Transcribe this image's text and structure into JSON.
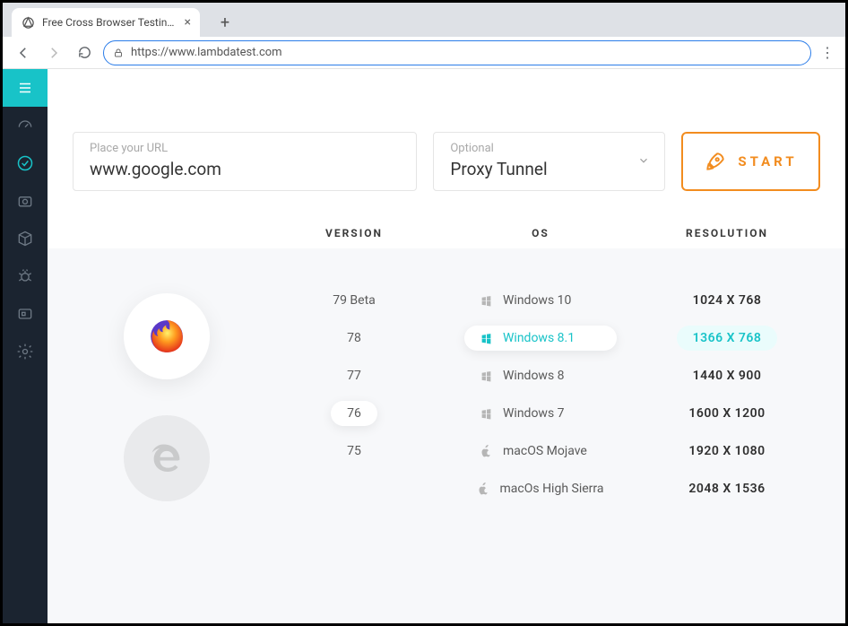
{
  "browser": {
    "tab_title": "Free Cross Browser Testing Clou",
    "url": "https://www.lambdatest.com"
  },
  "inputs": {
    "url_placeholder": "Place your URL",
    "url_value": "www.google.com",
    "proxy_placeholder": "Optional",
    "proxy_value": "Proxy Tunnel",
    "start_label": "START"
  },
  "headers": {
    "version": "VERSION",
    "os": "OS",
    "resolution": "RESOLUTION"
  },
  "versions": [
    {
      "label": "79 Beta",
      "selected": false
    },
    {
      "label": "78",
      "selected": false
    },
    {
      "label": "77",
      "selected": false
    },
    {
      "label": "76",
      "selected": true
    },
    {
      "label": "75",
      "selected": false
    }
  ],
  "oses": [
    {
      "label": "Windows 10",
      "icon": "windows",
      "selected": false
    },
    {
      "label": "Windows 8.1",
      "icon": "windows",
      "selected": true
    },
    {
      "label": "Windows 8",
      "icon": "windows",
      "selected": false
    },
    {
      "label": "Windows 7",
      "icon": "windows",
      "selected": false
    },
    {
      "label": "macOS Mojave",
      "icon": "apple",
      "selected": false
    },
    {
      "label": "macOs High Sierra",
      "icon": "apple",
      "selected": false
    }
  ],
  "resolutions": [
    {
      "label": "1024 X 768",
      "selected": false
    },
    {
      "label": "1366 X 768",
      "selected": true
    },
    {
      "label": "1440 X 900",
      "selected": false
    },
    {
      "label": "1600 X 1200",
      "selected": false
    },
    {
      "label": "1920 X 1080",
      "selected": false
    },
    {
      "label": "2048 X 1536",
      "selected": false
    }
  ]
}
